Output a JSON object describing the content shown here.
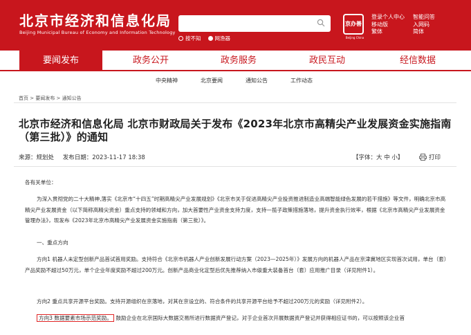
{
  "header": {
    "title": "北京市经济和信息化局",
    "subtitle": "Beijing Municipal Bureau of Economy and Information Technology",
    "search": {
      "option_site": "按不知",
      "option_web": "网渔器"
    },
    "seal": {
      "text": "京办善",
      "caption": "Beijing China"
    },
    "links_col1": [
      "登录个人中心",
      "移动版",
      "繁体"
    ],
    "links_col2": [
      "智能问答",
      "入网码",
      "简体"
    ]
  },
  "main_nav": [
    "要闻发布",
    "政务公开",
    "政务服务",
    "政民互动",
    "经信数据"
  ],
  "sub_nav": [
    "中央精神",
    "北京要闻",
    "通知公告",
    "工作动态"
  ],
  "breadcrumb": "首页 > 要闻发布 > 通知公告",
  "article": {
    "title": "北京市经济和信息化局 北京市财政局关于发布《2023年北京市高精尖产业发展资金实施指南（第三批）》的通知",
    "source": "来源：规划处",
    "date": "发布日期：2023-11-17 18:38",
    "font_size": "【字体：大 中 小】",
    "print_label": "打印",
    "greeting": "各有关单位：",
    "para1": "为深入贯彻党的二十大精神,落实《北京市“十四五”时期高精尖产业发展规划》《北京市关于促进高精尖产业投资推进制造业高端智能绿色发展的若干措施》等文件，明确北京市高精尖产业发展资金（以下简称高精尖资金）重点支持的领域和方向，加大首要性产业资金支持力度，支持一揽子政策措施落地，提升资金执行效率，根据《北京市高精尖产业发展资金管理办法》，现发布《2023年北京市高精尖产业发展资金实施指南（第三批）》。",
    "section1": "一、重点方向",
    "para2": "方向1 机器人未定型创新产品首试首用奖励。支持符合《北京市机器人产业创新发展行动方案（2023—2025年）》发展方向的机器人产品在京津冀地区实现首次试用，单台（套）产品奖励不超过50万元，单个企业年度奖励不超过200万元。创新产品商业化定型后优先推荐纳入市级重大装备首台（套）应用推广目录（详见附件1）。",
    "para3": "方向2 重点共享开源平台奖励。支持开源组织在京落地，对其在京设立的、符合条件的共享开源平台给予不超过200万元的奖励（详见附件2）。",
    "para4_highlight": "方向3 数据要素市场示范奖励。",
    "para4_rest": "鼓励企业在北京国际大数据交易所进行数据资产登记，对于企业首次开展数据资产登记并获得相应证书的，可以按照该企业首"
  }
}
